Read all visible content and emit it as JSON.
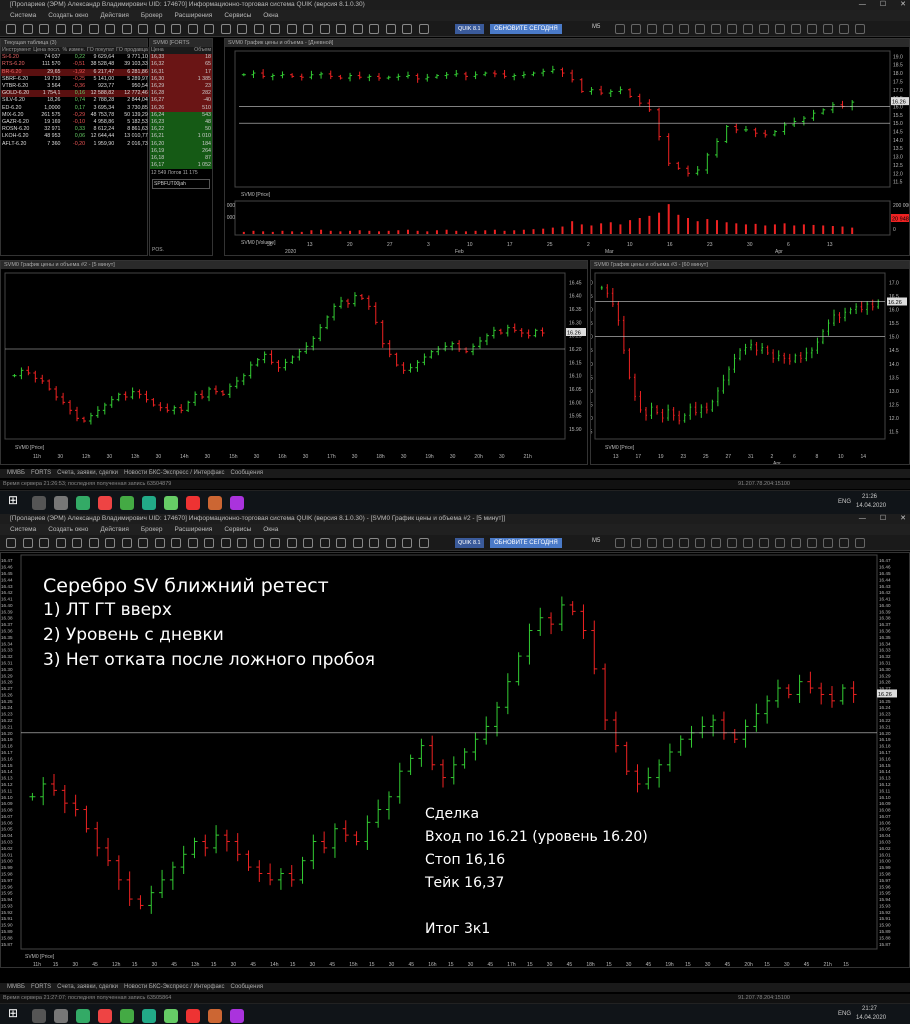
{
  "window": {
    "title": "[Пролариев (ЭРМ) Александр Владимирович UID: 174670] Информационно-торговая система QUIK (версия 8.1.0.30)",
    "title2": "[Пролариев (ЭРМ) Александр Владимирович UID: 174670] Информационно-торговая система QUIK (версия 8.1.0.30) - [SVM0 График цены и объема #2 - [5 минут]]"
  },
  "menu": [
    "Система",
    "Создать окно",
    "Действия",
    "Брокер",
    "Расширения",
    "Сервисы",
    "Окна"
  ],
  "toolbar": {
    "quik_label": "QUIK 8.1",
    "update_label": "ОБНОВИТЕ СЕГОДНЯ",
    "interval": "M5"
  },
  "quotes": {
    "title": "Текущая таблица (3)",
    "headers": [
      "Инструмент",
      "Цена посл.",
      "% измен.",
      "ГО покупат",
      "ГО продавца"
    ],
    "rows": [
      [
        "Si-6.20",
        "74 037",
        "0,22",
        "9 629,64",
        "9 771,10"
      ],
      [
        "RTS-6.20",
        "111 570",
        "-0,51",
        "38 528,48",
        "39 103,33"
      ],
      [
        "BR-6.20",
        "29,65",
        "-1,92",
        "6 217,47",
        "6 281,86"
      ],
      [
        "SBRF-6.20",
        "19 719",
        "-0,25",
        "5 141,00",
        "5 289,97"
      ],
      [
        "VTBR-6.20",
        "3 564",
        "-0,36",
        "923,77",
        "950,54"
      ],
      [
        "GOLD-6.20",
        "1 754,1",
        "0,16",
        "12 588,82",
        "12 772,46"
      ],
      [
        "SILV-6.20",
        "18,26",
        "0,74",
        "2 788,28",
        "2 844,04"
      ],
      [
        "ED-6.20",
        "1,0000",
        "0,17",
        "3 695,34",
        "3 730,85"
      ],
      [
        "MIX-6.20",
        "261 575",
        "-0,29",
        "48 753,78",
        "50 139,29"
      ],
      [
        "GAZR-6.20",
        "19 169",
        "-0,10",
        "4 958,86",
        "5 182,53"
      ],
      [
        "ROSN-6.20",
        "32 971",
        "0,33",
        "8 612,24",
        "8 861,63"
      ],
      [
        "LKOH-6.20",
        "48 953",
        "0,06",
        "12 644,44",
        "13 010,77"
      ],
      [
        "AFLT-6.20",
        "7 360",
        "-0,20",
        "1 959,90",
        "2 016,73"
      ]
    ]
  },
  "glass": {
    "title": "SVM0 [FORTS",
    "headers": [
      "Цена",
      "Объем"
    ],
    "asks": [
      [
        "16,33",
        "18"
      ],
      [
        "16,32",
        "65"
      ],
      [
        "16,31",
        "17"
      ],
      [
        "16,30",
        "1 385"
      ],
      [
        "16,29",
        "23"
      ],
      [
        "16,28",
        "282"
      ],
      [
        "16,27",
        "-40"
      ],
      [
        "16,26",
        "510"
      ]
    ],
    "bids": [
      [
        "16,24",
        "543"
      ],
      [
        "16,23",
        "48"
      ],
      [
        "16,22",
        "50"
      ],
      [
        "16,21",
        "1 010"
      ],
      [
        "16,20",
        "184"
      ],
      [
        "16,19",
        "264"
      ],
      [
        "16,18",
        "87"
      ],
      [
        "16,17",
        "1 052"
      ]
    ],
    "summary": "12 549 Лотов 11 175",
    "account": "SPBFUT00jah",
    "pos_label": "POS."
  },
  "daily": {
    "title": "SVM0 График цены и объема - [Дневной]",
    "legend": "SVM0 [Price]",
    "vol_legend": "SVM0 [Volume]",
    "price_current": "16.26",
    "vol_current": "20 948",
    "yticks": [
      "19.0",
      "18.5",
      "18.0",
      "17.5",
      "17.0",
      "16.5",
      "16.0",
      "15.5",
      "15.0",
      "14.5",
      "14.0",
      "13.5",
      "13.0",
      "12.5",
      "12.0",
      "11.5"
    ],
    "vol_ticks": [
      "200 000",
      "100 000",
      "0"
    ],
    "vol_ticks_left": [
      "200 000",
      "100 000",
      "0"
    ],
    "xticks": [
      "30",
      "13",
      "20",
      "27",
      "3",
      "10",
      "17",
      "25",
      "2",
      "10",
      "16",
      "23",
      "30",
      "6",
      "13"
    ],
    "months": [
      "2020",
      "Feb",
      "Mar",
      "Apr"
    ],
    "data": [
      17.9,
      18.0,
      17.8,
      17.85,
      17.9,
      17.8,
      17.75,
      17.9,
      17.95,
      17.8,
      17.7,
      17.85,
      17.75,
      17.8,
      17.7,
      17.75,
      17.8,
      17.85,
      17.65,
      17.75,
      17.85,
      17.9,
      17.95,
      17.8,
      17.9,
      18.0,
      17.95,
      17.8,
      17.85,
      17.9,
      18.0,
      18.1,
      18.2,
      18.0,
      17.6,
      16.9,
      17.0,
      16.8,
      16.9,
      17.0,
      16.6,
      16.2,
      15.8,
      14.2,
      12.6,
      12.3,
      12.0,
      12.2,
      13.1,
      13.9,
      14.8,
      14.6,
      14.6,
      14.4,
      14.3,
      14.5,
      14.9,
      15.1,
      15.3,
      15.6,
      15.8,
      16.1,
      16.0,
      16.26
    ],
    "volumes": [
      20000,
      30000,
      25000,
      20000,
      30000,
      25000,
      20000,
      35000,
      40000,
      30000,
      25000,
      30000,
      35000,
      30000,
      25000,
      30000,
      35000,
      40000,
      30000,
      25000,
      35000,
      40000,
      30000,
      25000,
      30000,
      35000,
      40000,
      30000,
      35000,
      40000,
      45000,
      50000,
      60000,
      70000,
      120000,
      90000,
      80000,
      100000,
      110000,
      90000,
      130000,
      150000,
      170000,
      200000,
      280000,
      180000,
      150000,
      120000,
      140000,
      130000,
      110000,
      100000,
      90000,
      95000,
      80000,
      90000,
      100000,
      80000,
      90000,
      85000,
      80000,
      75000,
      70000,
      60000
    ]
  },
  "chart5m": {
    "title": "SVM0 График цены и объема #2 - [5 минут]",
    "legend": "SVM0 [Price]",
    "price_current": "16.26",
    "yticks": [
      "16.45",
      "16.40",
      "16.35",
      "16.30",
      "16.25",
      "16.20",
      "16.15",
      "16.10",
      "16.05",
      "16.00",
      "15.95",
      "15.90"
    ],
    "xticks": [
      "11h",
      "30",
      "12h",
      "30",
      "13h",
      "30",
      "14h",
      "30",
      "15h",
      "30",
      "16h",
      "30",
      "17h",
      "30",
      "18h",
      "30",
      "19h",
      "30",
      "20h",
      "30",
      "21h"
    ],
    "level": 16.2,
    "data": [
      16.1,
      16.12,
      16.11,
      16.09,
      16.08,
      16.05,
      16.02,
      16.0,
      15.97,
      15.94,
      15.93,
      15.95,
      15.97,
      15.99,
      16.01,
      16.03,
      16.02,
      16.04,
      16.03,
      16.01,
      15.99,
      15.98,
      15.97,
      15.98,
      15.97,
      16.0,
      16.03,
      16.02,
      16.05,
      16.04,
      16.03,
      16.06,
      16.08,
      16.1,
      16.14,
      16.16,
      16.18,
      16.15,
      16.13,
      16.15,
      16.17,
      16.19,
      16.21,
      16.24,
      16.28,
      16.32,
      16.36,
      16.38,
      16.37,
      16.4,
      16.39,
      16.36,
      16.3,
      16.22,
      16.18,
      16.14,
      16.12,
      16.13,
      16.15,
      16.17,
      16.19,
      16.2,
      16.21,
      16.22,
      16.2,
      16.19,
      16.21,
      16.23,
      16.25,
      16.27,
      16.26,
      16.28,
      16.27,
      16.26,
      16.25,
      16.27,
      16.26
    ]
  },
  "chart60m": {
    "title": "SVM0 График цены и объема #3 - [60 минут]",
    "legend": "SVM0 [Price]",
    "price_current": "16.26",
    "yticks": [
      "17.0",
      "16.5",
      "16.0",
      "15.5",
      "15.0",
      "14.5",
      "14.0",
      "13.5",
      "13.0",
      "12.5",
      "12.0",
      "11.5"
    ],
    "xticks": [
      "13",
      "17",
      "19",
      "23",
      "25",
      "27",
      "31",
      "2",
      "6",
      "8",
      "10",
      "14"
    ],
    "months": [
      "Apr"
    ],
    "data": [
      16.8,
      16.6,
      16.2,
      15.6,
      14.5,
      13.5,
      12.8,
      12.3,
      12.1,
      12.4,
      12.2,
      12.0,
      12.3,
      12.1,
      11.9,
      12.1,
      12.4,
      12.2,
      12.4,
      12.3,
      12.6,
      13.0,
      13.4,
      13.8,
      14.2,
      14.5,
      14.6,
      14.7,
      14.5,
      14.6,
      14.4,
      14.2,
      14.3,
      14.2,
      14.1,
      14.3,
      14.2,
      14.4,
      14.5,
      14.8,
      15.2,
      15.5,
      15.8,
      15.7,
      15.9,
      16.0,
      16.1,
      16.0,
      16.2,
      16.1,
      16.3
    ]
  },
  "tabs": [
    "ММВБ",
    "FORTS",
    "Счета, заявки, сделки",
    "Новости БКС-Экспресс / Интерфакс",
    "Сообщения"
  ],
  "status_top": {
    "left": "Время сервера 21:26:53; последняя полученная запись 63504879",
    "ip": "91.207.78.204:15100"
  },
  "status_bottom": {
    "left": "Время сервера 21:27:07; последняя полученная запись 63505864",
    "ip": "91.207.78.204:15100"
  },
  "taskbar_top": {
    "lang": "ENG",
    "time": "21:26",
    "date": "14.04.2020"
  },
  "taskbar_bottom": {
    "lang": "ENG",
    "time": "21:27",
    "date": "14.04.2020"
  },
  "big_chart": {
    "legend": "SVM0 [Price]",
    "price_current": "16.26",
    "level": 16.2,
    "yticks": [
      "16.47",
      "16.46",
      "16.45",
      "16.44",
      "16.43",
      "16.42",
      "16.41",
      "16.40",
      "16.39",
      "16.38",
      "16.37",
      "16.36",
      "16.35",
      "16.34",
      "16.33",
      "16.32",
      "16.31",
      "16.30",
      "16.29",
      "16.28",
      "16.27",
      "16.26",
      "16.25",
      "16.24",
      "16.23",
      "16.22",
      "16.21",
      "16.20",
      "16.19",
      "16.18",
      "16.17",
      "16.16",
      "16.15",
      "16.14",
      "16.13",
      "16.12",
      "16.11",
      "16.10",
      "16.09",
      "16.08",
      "16.07",
      "16.06",
      "16.05",
      "16.04",
      "16.03",
      "16.02",
      "16.01",
      "16.00",
      "15.99",
      "15.98",
      "15.97",
      "15.96",
      "15.95",
      "15.94",
      "15.93",
      "15.92",
      "15.91",
      "15.90",
      "15.89",
      "15.88",
      "15.87"
    ],
    "xticks": [
      "11h",
      "15",
      "30",
      "45",
      "12h",
      "15",
      "30",
      "45",
      "13h",
      "15",
      "30",
      "45",
      "14h",
      "15",
      "30",
      "45",
      "15h",
      "15",
      "30",
      "45",
      "16h",
      "15",
      "30",
      "45",
      "17h",
      "15",
      "30",
      "45",
      "18h",
      "15",
      "30",
      "45",
      "19h",
      "15",
      "30",
      "45",
      "20h",
      "15",
      "30",
      "45",
      "21h",
      "15"
    ],
    "annotation": {
      "title": "Серебро SV ближний ретест",
      "points": [
        "1)  ЛТ ГТ вверх",
        "2) Уровень с дневки",
        "3)  Нет отката после ложного пробоя"
      ],
      "deal": [
        "Сделка",
        "Вход по 16.21 (уровень 16.20)",
        "Стоп 16,16",
        "Тейк 16,37",
        "",
        "Итог 3к1"
      ]
    },
    "data": [
      16.1,
      16.12,
      16.11,
      16.09,
      16.08,
      16.05,
      16.02,
      16.0,
      15.97,
      15.94,
      15.93,
      15.95,
      15.97,
      15.99,
      16.01,
      16.03,
      16.02,
      16.04,
      16.03,
      16.01,
      15.99,
      15.98,
      15.97,
      15.98,
      15.97,
      16.0,
      16.03,
      16.02,
      16.05,
      16.04,
      16.03,
      16.06,
      16.08,
      16.1,
      16.14,
      16.16,
      16.18,
      16.15,
      16.13,
      16.15,
      16.17,
      16.19,
      16.21,
      16.24,
      16.28,
      16.32,
      16.36,
      16.38,
      16.37,
      16.4,
      16.39,
      16.36,
      16.3,
      16.22,
      16.18,
      16.14,
      16.12,
      16.13,
      16.15,
      16.17,
      16.19,
      16.2,
      16.21,
      16.22,
      16.2,
      16.19,
      16.21,
      16.23,
      16.25,
      16.27,
      16.26,
      16.28,
      16.27,
      16.26,
      16.25,
      16.27,
      16.26
    ]
  }
}
